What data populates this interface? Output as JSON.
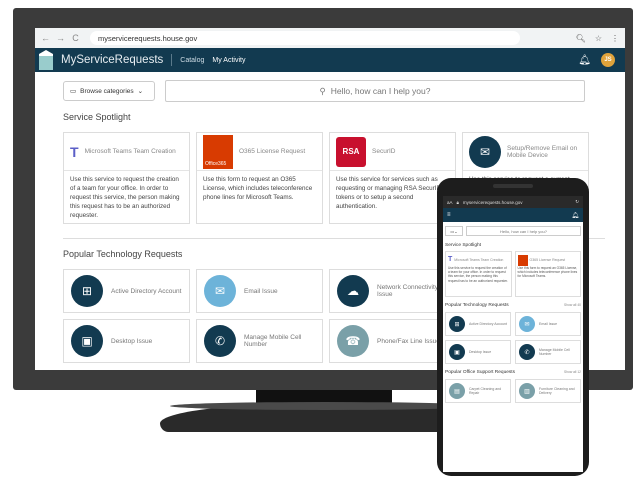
{
  "browser": {
    "url": "myservicerequests.house.gov"
  },
  "header": {
    "brand": "MyServiceRequests",
    "nav": [
      "Catalog",
      "My Activity"
    ],
    "avatar_initials": "JS"
  },
  "toolbar": {
    "browse_label": "Browse categories",
    "search_placeholder": "Hello, how can I help you?"
  },
  "spotlight": {
    "title": "Service Spotlight",
    "cards": [
      {
        "title": "Microsoft Teams Team Creation",
        "icon": "teams-icon",
        "desc": "Use this service to request the creation of a team for your office. In order to request this service, the person making this request has to be an authorized requester."
      },
      {
        "title": "O365 License Request",
        "icon": "office-icon",
        "badge": "Office365",
        "desc": "Use this form to request an O365 License, which includes teleconference phone lines for Microsoft Teams."
      },
      {
        "title": "SecurID",
        "icon": "rsa-icon",
        "badge": "RSA",
        "desc": "Use this service for services such as requesting or managing RSA SecurID tokens or to setup a second authentication."
      },
      {
        "title": "Setup/Remove Email on Mobile Device",
        "icon": "mobile-email-icon",
        "desc": "Use this service to request a current"
      }
    ]
  },
  "popular": {
    "title": "Popular Technology Requests",
    "items": [
      {
        "label": "Active Directory Account",
        "icon": "windows-icon"
      },
      {
        "label": "Email Issue",
        "icon": "email-icon"
      },
      {
        "label": "Network Connectivity Issue",
        "icon": "network-icon"
      },
      {
        "label": "",
        "icon": "blank"
      },
      {
        "label": "Desktop Issue",
        "icon": "desktop-icon"
      },
      {
        "label": "Manage Mobile Cell Number",
        "icon": "phone-icon"
      },
      {
        "label": "Phone/Fax Line Issue",
        "icon": "deskphone-icon"
      },
      {
        "label": "",
        "icon": "blank"
      }
    ]
  },
  "mobile": {
    "url": "myservicerequests.house.gov",
    "search_placeholder": "Hello, how can I help you?",
    "spotlight_title": "Service Spotlight",
    "spot_cards": [
      {
        "title": "Microsoft Teams Team Creation",
        "desc": "Use this service to request the creation of a team for your office. In order to request this service, the person making this request has to be an authorized requester."
      },
      {
        "title": "O365 License Request",
        "desc": "Use this form to request an O365 License, which includes teleconference phone lines for Microsoft Teams."
      }
    ],
    "popular_title": "Popular Technology Requests",
    "popular_more": "Show all 40",
    "popular_items": [
      "Active Directory Account",
      "Email Issue",
      "Desktop Issue",
      "Manage Mobile Cell Number"
    ],
    "office_title": "Popular Office Support Requests",
    "office_more": "Show all 12",
    "office_items": [
      "Carpet Cleaning and Repair",
      "Furniture Cleaning and Delivery"
    ]
  }
}
